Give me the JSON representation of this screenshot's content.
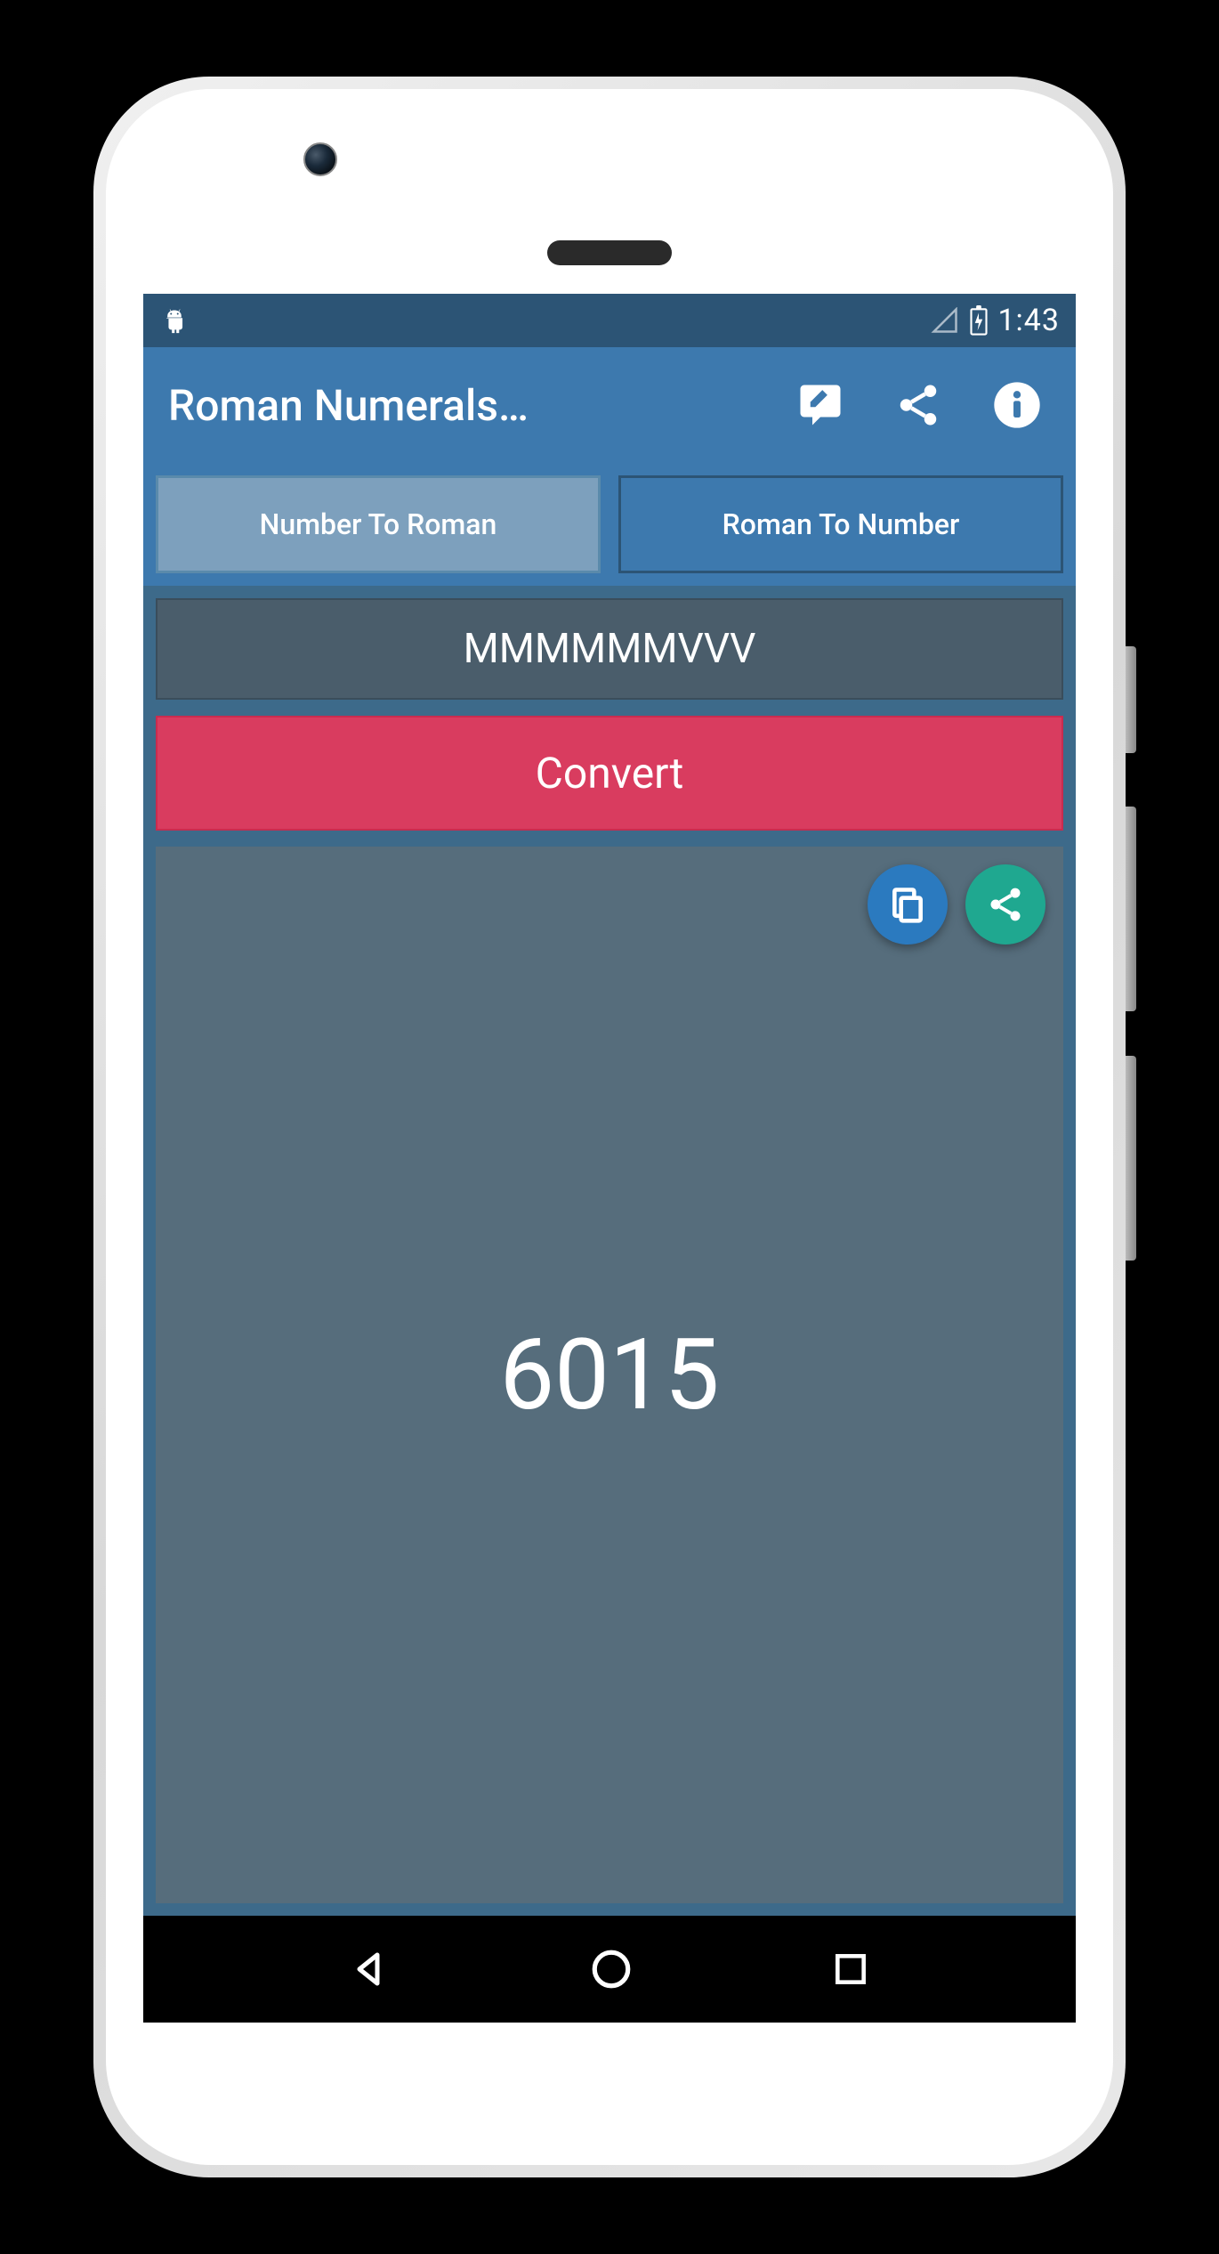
{
  "status": {
    "time": "1:43"
  },
  "appbar": {
    "title": "Roman Numerals…"
  },
  "tabs": {
    "numberToRoman": "Number To Roman",
    "romanToNumber": "Roman To Number"
  },
  "input": {
    "value": "MMMMMMVVV"
  },
  "actions": {
    "convert": "Convert"
  },
  "result": {
    "value": "6015"
  }
}
